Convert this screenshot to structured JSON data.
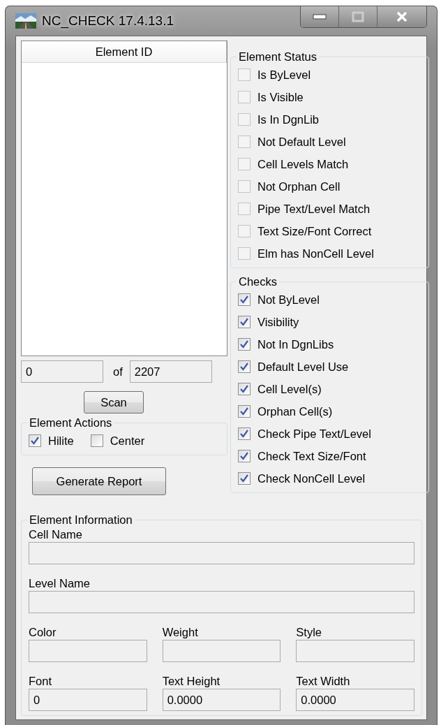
{
  "window": {
    "title": "NC_CHECK 17.4.13.1"
  },
  "element_list": {
    "column": "Element ID"
  },
  "counter": {
    "current": "0",
    "separator": "of",
    "total": "2207"
  },
  "scan_button": "Scan",
  "element_actions": {
    "title": "Element Actions",
    "options": [
      {
        "label": "Hilite",
        "checked": true
      },
      {
        "label": "Center",
        "checked": false
      }
    ]
  },
  "report_button": "Generate Report",
  "element_status": {
    "title": "Element Status",
    "items": [
      {
        "label": "Is ByLevel",
        "checked": false,
        "disabled": true
      },
      {
        "label": "Is Visible",
        "checked": false,
        "disabled": true
      },
      {
        "label": "Is In DgnLib",
        "checked": false,
        "disabled": true
      },
      {
        "label": "Not Default Level",
        "checked": false,
        "disabled": true
      },
      {
        "label": "Cell Levels Match",
        "checked": false,
        "disabled": true
      },
      {
        "label": "Not Orphan Cell",
        "checked": false,
        "disabled": true
      },
      {
        "label": "Pipe Text/Level Match",
        "checked": false,
        "disabled": true
      },
      {
        "label": "Text Size/Font Correct",
        "checked": false,
        "disabled": true
      },
      {
        "label": "Elm has NonCell Level",
        "checked": false,
        "disabled": true
      }
    ]
  },
  "checks": {
    "title": "Checks",
    "items": [
      {
        "label": "Not ByLevel",
        "checked": true,
        "disabled": false
      },
      {
        "label": "Visibility",
        "checked": true,
        "disabled": false
      },
      {
        "label": "Not In DgnLibs",
        "checked": true,
        "disabled": false
      },
      {
        "label": "Default Level Use",
        "checked": true,
        "disabled": false
      },
      {
        "label": "Cell Level(s)",
        "checked": true,
        "disabled": false
      },
      {
        "label": "Orphan Cell(s)",
        "checked": true,
        "disabled": false
      },
      {
        "label": "Check Pipe Text/Level",
        "checked": true,
        "disabled": false
      },
      {
        "label": "Check Text Size/Font",
        "checked": true,
        "disabled": false
      },
      {
        "label": "Check NonCell Level",
        "checked": true,
        "disabled": false
      }
    ]
  },
  "element_information": {
    "title": "Element Information",
    "rows": [
      {
        "fields": [
          {
            "label": "Cell Name"
          }
        ]
      },
      {
        "fields": [
          {
            "label": "Level Name"
          }
        ]
      },
      {
        "fields": [
          {
            "label": "Color"
          },
          {
            "label": "Weight"
          },
          {
            "label": "Style"
          }
        ]
      },
      {
        "fields": [
          {
            "label": "Font",
            "value": "0"
          },
          {
            "label": "Text Height",
            "value": "0.0000"
          },
          {
            "label": "Text Width",
            "value": "0.0000"
          }
        ]
      }
    ]
  }
}
